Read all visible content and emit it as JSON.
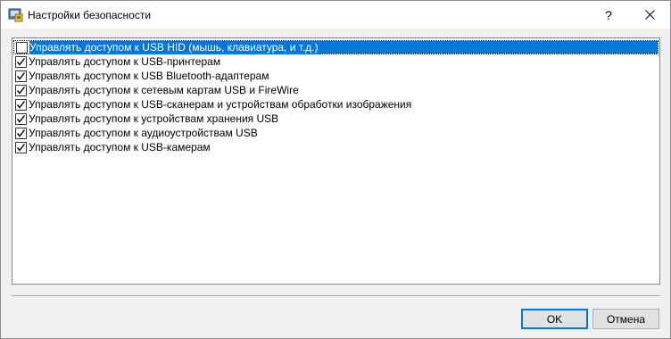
{
  "window": {
    "title": "Настройки безопасности",
    "help_label": "?",
    "accent_color": "#0078d7"
  },
  "list": {
    "items": [
      {
        "label": "Управлять доступом к USB HID (мышь, клавиатура, и т.д.)",
        "checked": false,
        "selected": true
      },
      {
        "label": "Управлять доступом к USB-принтерам",
        "checked": true,
        "selected": false
      },
      {
        "label": "Управлять доступом к USB Bluetooth-адаптерам",
        "checked": true,
        "selected": false
      },
      {
        "label": "Управлять доступом к сетевым картам USB и FireWire",
        "checked": true,
        "selected": false
      },
      {
        "label": "Управлять доступом к USB-сканерам и устройствам обработки изображения",
        "checked": true,
        "selected": false
      },
      {
        "label": "Управлять доступом к устройствам хранения USB",
        "checked": true,
        "selected": false
      },
      {
        "label": "Управлять доступом к аудиоустройствам USB",
        "checked": true,
        "selected": false
      },
      {
        "label": "Управлять доступом к USB-камерам",
        "checked": true,
        "selected": false
      }
    ]
  },
  "buttons": {
    "ok_label": "OK",
    "cancel_label": "Отмена"
  },
  "icons": {
    "app": "security-settings-icon",
    "close": "close-icon",
    "check": "checkmark-icon"
  }
}
